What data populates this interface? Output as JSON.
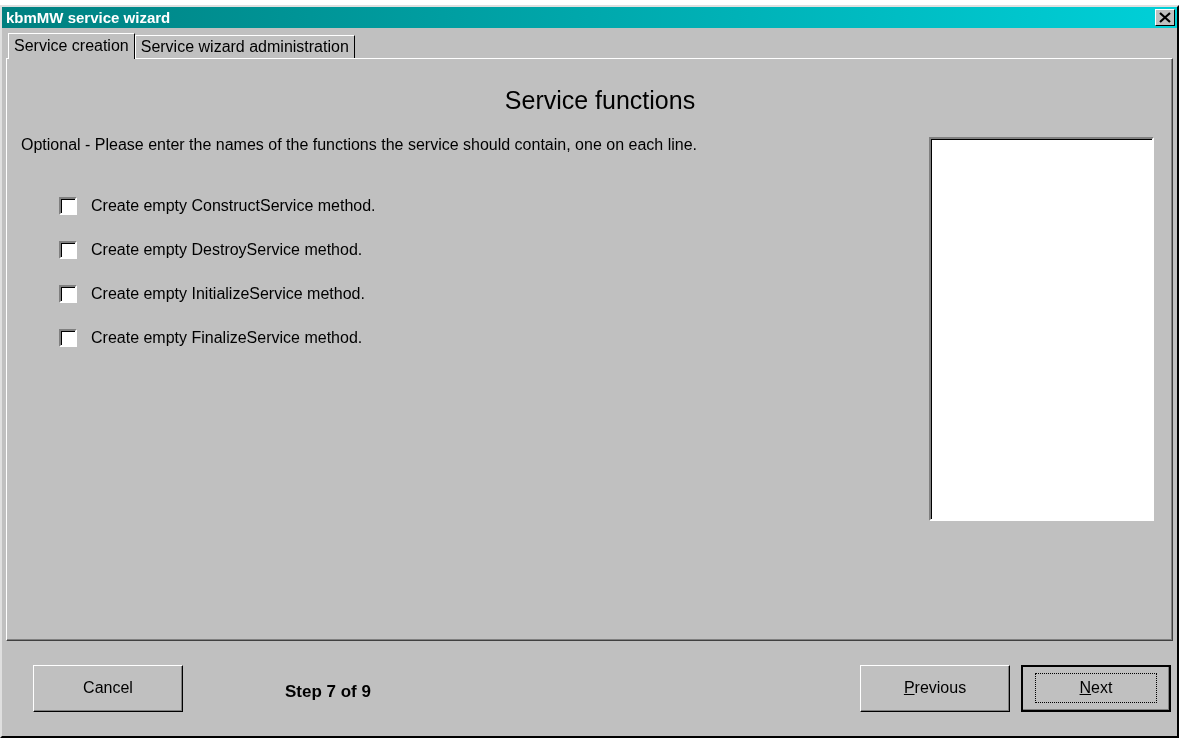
{
  "window": {
    "title": "kbmMW service wizard"
  },
  "tabs": [
    {
      "label": "Service creation",
      "selected": true
    },
    {
      "label": "Service wizard administration",
      "selected": false
    }
  ],
  "page": {
    "heading": "Service functions",
    "instructions": "Optional - Please enter the names of the functions the service should contain, one on each line."
  },
  "options": [
    {
      "label": "Create empty ConstructService method.",
      "checked": false
    },
    {
      "label": "Create empty DestroyService method.",
      "checked": false
    },
    {
      "label": "Create empty InitializeService method.",
      "checked": false
    },
    {
      "label": "Create empty FinalizeService method.",
      "checked": false
    }
  ],
  "footer": {
    "cancel": {
      "label": "Cancel"
    },
    "step": "Step 7 of 9",
    "buttons": [
      {
        "label": "Previous",
        "underline_first": true,
        "default": false
      },
      {
        "label": "Next",
        "underline_first": true,
        "default": true
      }
    ]
  }
}
